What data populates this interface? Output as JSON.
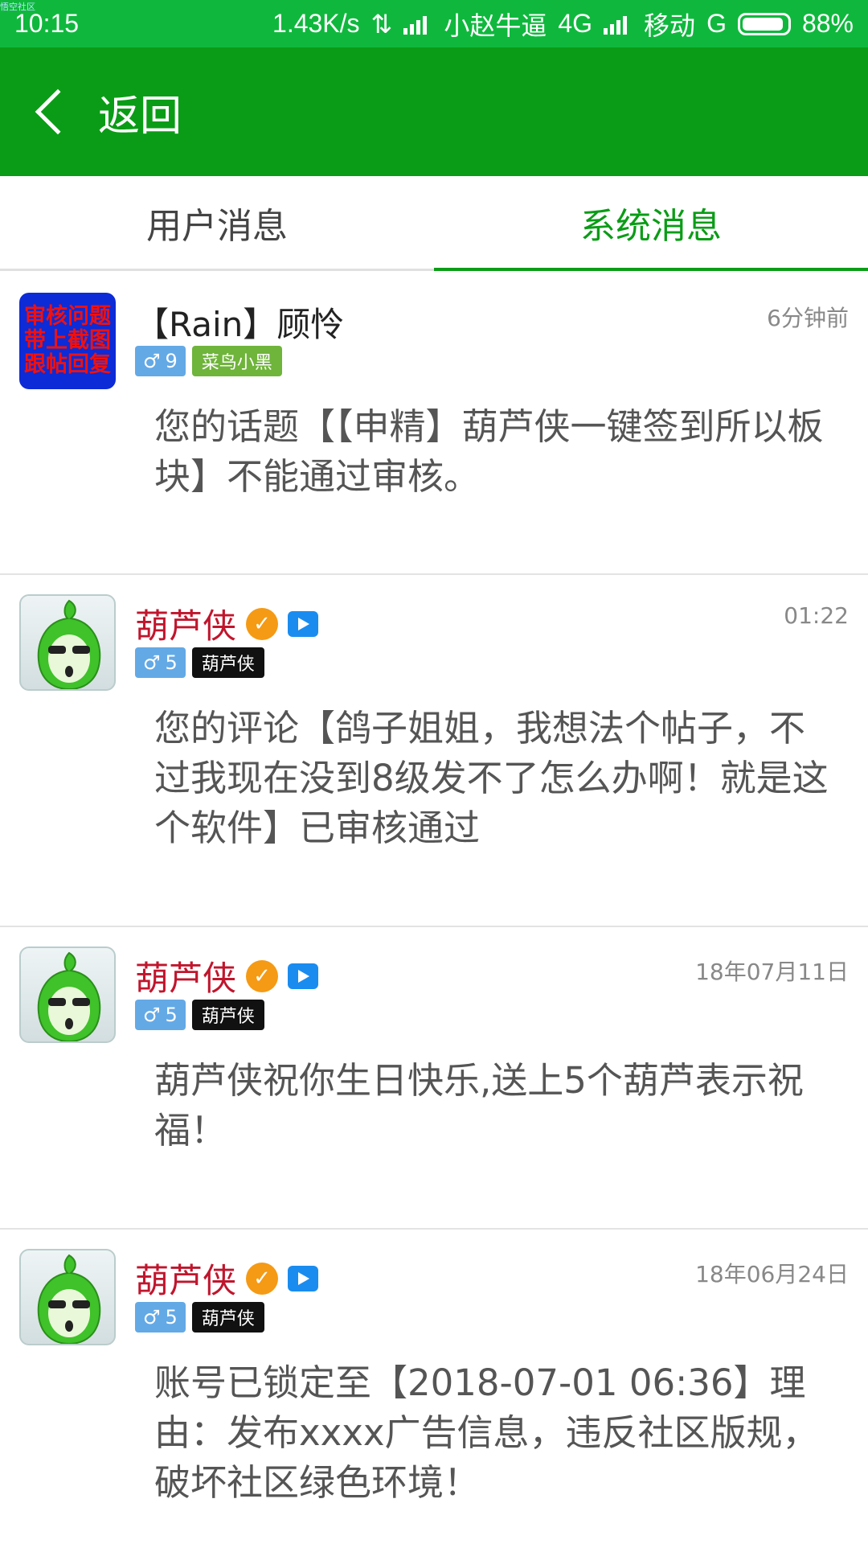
{
  "status_bar": {
    "tiny_label": "悟空社区",
    "time": "10:15",
    "speed": "1.43K/s",
    "carrier1": "小赵牛逼",
    "net1": "4G",
    "carrier2": "移动",
    "net2": "G",
    "battery": "88%"
  },
  "header": {
    "back_label": "返回"
  },
  "tabs": [
    {
      "label": "用户消息",
      "active": false
    },
    {
      "label": "系统消息",
      "active": true
    }
  ],
  "messages": [
    {
      "name": "【Rain】顾怜",
      "avatar_lines": [
        "审核问题",
        "带上截图",
        "跟帖回复"
      ],
      "level": "9",
      "title_badge": "菜鸟小黑",
      "time": "6分钟前",
      "body": "您的话题【【申精】葫芦侠一键签到所以板块】不能通过审核。"
    },
    {
      "name": "葫芦侠",
      "level": "5",
      "title_badge": "葫芦侠",
      "time": "01:22",
      "body": "您的评论【鸽子姐姐，我想法个帖子，不过我现在没到8级发不了怎么办啊！就是这个软件】已审核通过"
    },
    {
      "name": "葫芦侠",
      "level": "5",
      "title_badge": "葫芦侠",
      "time": "18年07月11日",
      "body": "葫芦侠祝你生日快乐,送上5个葫芦表示祝福！"
    },
    {
      "name": "葫芦侠",
      "level": "5",
      "title_badge": "葫芦侠",
      "time": "18年06月24日",
      "body": "账号已锁定至【2018-07-01 06:36】理由：发布xxxx广告信息，违反社区版规，破坏社区绿色环境！"
    }
  ],
  "icons": {
    "gender": "male-icon",
    "verified": "verified-check-icon",
    "video": "video-icon"
  },
  "colors": {
    "status_bar": "#0fb83d",
    "app_bar": "#0a9c16",
    "active_tab": "#0a9c16",
    "official_name": "#c0162d"
  }
}
